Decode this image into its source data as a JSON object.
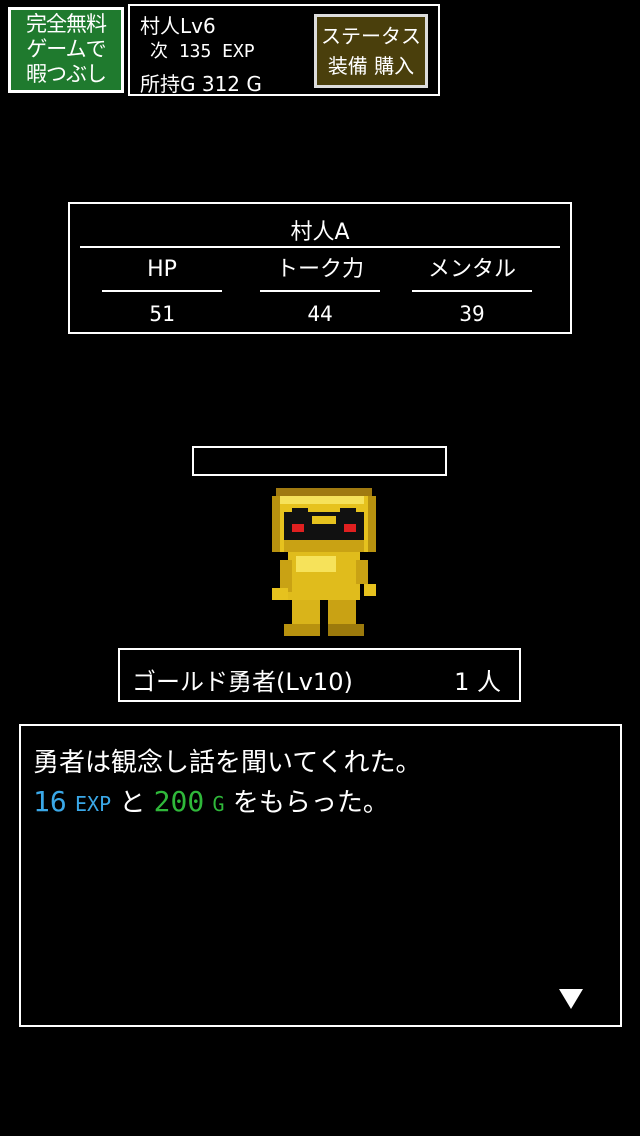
{
  "ad": {
    "line1": "完全無料",
    "line2": "ゲームで",
    "line3": "暇つぶし"
  },
  "player": {
    "name_level": "村人Lv6",
    "next_exp": "次 135 EXP",
    "gold": "所持G 312 G"
  },
  "menu": {
    "line1": "ステータス",
    "line2": "装備 購入"
  },
  "enemy_stats": {
    "name": "村人A",
    "hp_label": "HP",
    "hp_value": "51",
    "talk_label": "トーク力",
    "talk_value": "44",
    "mental_label": "メンタル",
    "mental_value": "39"
  },
  "hp_bar": {
    "fill_fraction": 0
  },
  "enemy": {
    "name": "ゴールド勇者(Lv10)",
    "count": "1 人",
    "sprite_icon": "gold-hero-sprite"
  },
  "message": {
    "line1": "勇者は観念し話を聞いてくれた。",
    "exp_value": "16",
    "exp_unit": "EXP",
    "and_text": "と",
    "gold_value": "200",
    "gold_unit": "G",
    "received_text": "をもらった。"
  },
  "colors": {
    "exp": "#3aa8e8",
    "gold": "#2fb83a",
    "ad_bg": "#1f7a2e",
    "menu_bg": "#4a3f0c"
  },
  "next_icon": "triangle-down-icon"
}
